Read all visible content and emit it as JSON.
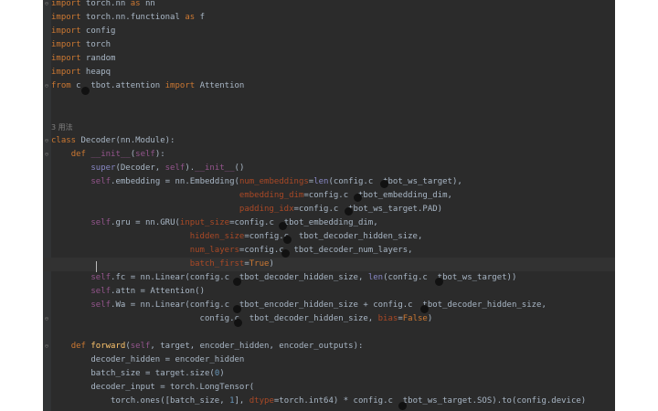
{
  "code": {
    "lines": [
      {
        "tokens": [
          {
            "t": "kw",
            "v": "import"
          },
          {
            "t": "id",
            "v": " torch.nn "
          },
          {
            "t": "kw",
            "v": "as"
          },
          {
            "t": "id",
            "v": " nn"
          }
        ]
      },
      {
        "tokens": [
          {
            "t": "kw",
            "v": "import"
          },
          {
            "t": "id",
            "v": " torch.nn.functional "
          },
          {
            "t": "kw",
            "v": "as"
          },
          {
            "t": "id",
            "v": " f"
          }
        ]
      },
      {
        "tokens": [
          {
            "t": "kw",
            "v": "import"
          },
          {
            "t": "id",
            "v": " config"
          }
        ]
      },
      {
        "tokens": [
          {
            "t": "kw",
            "v": "import"
          },
          {
            "t": "id",
            "v": " torch"
          }
        ]
      },
      {
        "tokens": [
          {
            "t": "kw",
            "v": "import"
          },
          {
            "t": "id",
            "v": " random"
          }
        ]
      },
      {
        "tokens": [
          {
            "t": "kw",
            "v": "import"
          },
          {
            "t": "id",
            "v": " heapq"
          }
        ]
      },
      {
        "tokens": [
          {
            "t": "kw",
            "v": "from"
          },
          {
            "t": "id",
            "v": " c  tbot.attention "
          },
          {
            "t": "kw",
            "v": "import"
          },
          {
            "t": "id",
            "v": " Attention"
          }
        ]
      },
      {
        "tokens": []
      },
      {
        "tokens": []
      },
      {
        "tokens": [
          {
            "t": "usage",
            "v": "3 用法"
          }
        ]
      },
      {
        "tokens": [
          {
            "t": "kw",
            "v": "class"
          },
          {
            "t": "id",
            "v": " Decoder(nn.Module):"
          }
        ]
      },
      {
        "tokens": [
          {
            "t": "id",
            "v": "    "
          },
          {
            "t": "kw",
            "v": "def"
          },
          {
            "t": "id",
            "v": " "
          },
          {
            "t": "mag",
            "v": "__init__"
          },
          {
            "t": "id",
            "v": "("
          },
          {
            "t": "mag",
            "v": "self"
          },
          {
            "t": "id",
            "v": "):"
          }
        ]
      },
      {
        "tokens": [
          {
            "t": "id",
            "v": "        "
          },
          {
            "t": "bi",
            "v": "super"
          },
          {
            "t": "id",
            "v": "(Decoder, "
          },
          {
            "t": "mag",
            "v": "self"
          },
          {
            "t": "id",
            "v": ")."
          },
          {
            "t": "mag",
            "v": "__init__"
          },
          {
            "t": "id",
            "v": "()"
          }
        ]
      },
      {
        "tokens": [
          {
            "t": "id",
            "v": "        "
          },
          {
            "t": "mag",
            "v": "self"
          },
          {
            "t": "id",
            "v": ".embedding = nn.Embedding("
          },
          {
            "t": "param",
            "v": "num_embeddings"
          },
          {
            "t": "id",
            "v": "="
          },
          {
            "t": "bi",
            "v": "len"
          },
          {
            "t": "id",
            "v": "(config.c  tbot_ws_target),"
          }
        ]
      },
      {
        "tokens": [
          {
            "t": "id",
            "v": "                                      "
          },
          {
            "t": "param",
            "v": "embedding_dim"
          },
          {
            "t": "id",
            "v": "=config.c  tbot_embedding_dim,"
          }
        ]
      },
      {
        "tokens": [
          {
            "t": "id",
            "v": "                                      "
          },
          {
            "t": "param",
            "v": "padding_idx"
          },
          {
            "t": "id",
            "v": "=config.c  tbot_ws_target.PAD)"
          }
        ]
      },
      {
        "tokens": [
          {
            "t": "id",
            "v": "        "
          },
          {
            "t": "mag",
            "v": "self"
          },
          {
            "t": "id",
            "v": ".gru = nn.GRU("
          },
          {
            "t": "param",
            "v": "input_size"
          },
          {
            "t": "id",
            "v": "=config.c  tbot_embedding_dim,"
          }
        ]
      },
      {
        "tokens": [
          {
            "t": "id",
            "v": "                            "
          },
          {
            "t": "param",
            "v": "hidden_size"
          },
          {
            "t": "id",
            "v": "=config.c  tbot_decoder_hidden_size,"
          }
        ]
      },
      {
        "tokens": [
          {
            "t": "id",
            "v": "                            "
          },
          {
            "t": "param",
            "v": "num_layers"
          },
          {
            "t": "id",
            "v": "=config.c  tbot_decoder_num_layers,"
          }
        ]
      },
      {
        "tokens": [
          {
            "t": "id",
            "v": "                            "
          },
          {
            "t": "param",
            "v": "batch_first"
          },
          {
            "t": "id",
            "v": "="
          },
          {
            "t": "kw",
            "v": "True"
          },
          {
            "t": "id",
            "v": ")"
          }
        ]
      },
      {
        "tokens": [
          {
            "t": "id",
            "v": "        "
          },
          {
            "t": "mag",
            "v": "self"
          },
          {
            "t": "id",
            "v": ".fc = nn.Linear(config.c  tbot_decoder_hidden_size, "
          },
          {
            "t": "bi",
            "v": "len"
          },
          {
            "t": "id",
            "v": "(config.c  tbot_ws_target))"
          }
        ]
      },
      {
        "tokens": [
          {
            "t": "id",
            "v": "        "
          },
          {
            "t": "mag",
            "v": "self"
          },
          {
            "t": "id",
            "v": ".attn = Attention()"
          }
        ]
      },
      {
        "tokens": [
          {
            "t": "id",
            "v": "        "
          },
          {
            "t": "mag",
            "v": "self"
          },
          {
            "t": "id",
            "v": ".Wa = nn.Linear(config.c  tbot_encoder_hidden_size + config.c  tbot_decoder_hidden_size,"
          }
        ]
      },
      {
        "tokens": [
          {
            "t": "id",
            "v": "                              config.c  tbot_decoder_hidden_size, "
          },
          {
            "t": "param",
            "v": "bias"
          },
          {
            "t": "id",
            "v": "="
          },
          {
            "t": "kw",
            "v": "False"
          },
          {
            "t": "id",
            "v": ")"
          }
        ]
      },
      {
        "tokens": []
      },
      {
        "tokens": [
          {
            "t": "id",
            "v": "    "
          },
          {
            "t": "kw",
            "v": "def"
          },
          {
            "t": "id",
            "v": " "
          },
          {
            "t": "fn",
            "v": "forward"
          },
          {
            "t": "id",
            "v": "("
          },
          {
            "t": "mag",
            "v": "self"
          },
          {
            "t": "id",
            "v": ", target, encoder_hidden, encoder_outputs):"
          }
        ]
      },
      {
        "tokens": [
          {
            "t": "id",
            "v": "        decoder_hidden = encoder_hidden"
          }
        ]
      },
      {
        "tokens": [
          {
            "t": "id",
            "v": "        batch_size = target.size("
          },
          {
            "t": "num",
            "v": "0"
          },
          {
            "t": "id",
            "v": ")"
          }
        ]
      },
      {
        "tokens": [
          {
            "t": "id",
            "v": "        decoder_input = torch.LongTensor("
          }
        ]
      },
      {
        "tokens": [
          {
            "t": "id",
            "v": "            torch.ones([batch_size, "
          },
          {
            "t": "num",
            "v": "1"
          },
          {
            "t": "id",
            "v": "], "
          },
          {
            "t": "param",
            "v": "dtype"
          },
          {
            "t": "id",
            "v": "=torch.int64) * config.c  tbot_ws_target.SOS).to(config.device)"
          }
        ]
      }
    ]
  },
  "gutter": {
    "fold_markers": [
      {
        "line": 0,
        "glyph": "⊖"
      },
      {
        "line": 6,
        "glyph": "⊖"
      },
      {
        "line": 10,
        "glyph": "⊖"
      },
      {
        "line": 11,
        "glyph": "⊖"
      },
      {
        "line": 23,
        "glyph": "⊖"
      },
      {
        "line": 25,
        "glyph": "⊖"
      }
    ]
  },
  "colors": {
    "editor_background": "#2b2b2b",
    "keyword": "#cc7832",
    "identifier": "#a9b7c6",
    "function_name": "#ffc66d",
    "magic": "#94558d",
    "number": "#6897bb",
    "named_parameter": "#aa4926",
    "builtin": "#8888c6"
  }
}
